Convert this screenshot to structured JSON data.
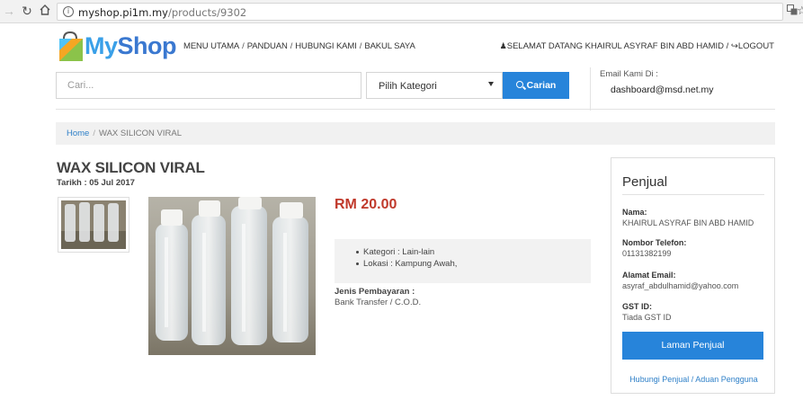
{
  "browser": {
    "url_host": "myshop.pi1m.my",
    "url_path": "/products/9302"
  },
  "brand": {
    "part1": "My",
    "part2": "Shop"
  },
  "topnav": {
    "items": [
      "MENU UTAMA",
      "PANDUAN",
      "HUBUNGI KAMI",
      "BAKUL SAYA"
    ],
    "separator": "/"
  },
  "usernav": {
    "greeting": "SELAMAT DATANG KHAIRUL ASYRAF BIN ABD HAMID",
    "separator": "/",
    "logout": "LOGOUT"
  },
  "search": {
    "placeholder": "Cari...",
    "category_selected": "Pilih Kategori",
    "button_label": "Carian"
  },
  "contact": {
    "label": "Email Kami Di :",
    "email": "dashboard@msd.net.my"
  },
  "breadcrumb": {
    "home": "Home",
    "separator": "/",
    "current": "WAX SILICON VIRAL"
  },
  "product": {
    "title": "WAX SILICON VIRAL",
    "date": "Tarikh : 05 Jul 2017",
    "price": "RM 20.00",
    "attributes": [
      "Kategori : Lain-lain",
      "Lokasi : Kampung Awah,"
    ],
    "payment_label": "Jenis Pembayaran :",
    "payment_value": "Bank Transfer / C.O.D."
  },
  "seller": {
    "title": "Penjual",
    "name_label": "Nama:",
    "name_value": "KHAIRUL ASYRAF BIN ABD HAMID",
    "phone_label": "Nombor Telefon:",
    "phone_value": "01131382199",
    "email_label": "Alamat Email:",
    "email_value": "asyraf_abdulhamid@yahoo.com",
    "gst_label": "GST ID:",
    "gst_value": "Tiada GST ID",
    "button_label": "Laman Penjual",
    "link_label": "Hubungi Penjual / Aduan Pengguna"
  },
  "colors": {
    "accent": "#2784da",
    "price": "#c0392b",
    "link": "#2f80c8"
  }
}
